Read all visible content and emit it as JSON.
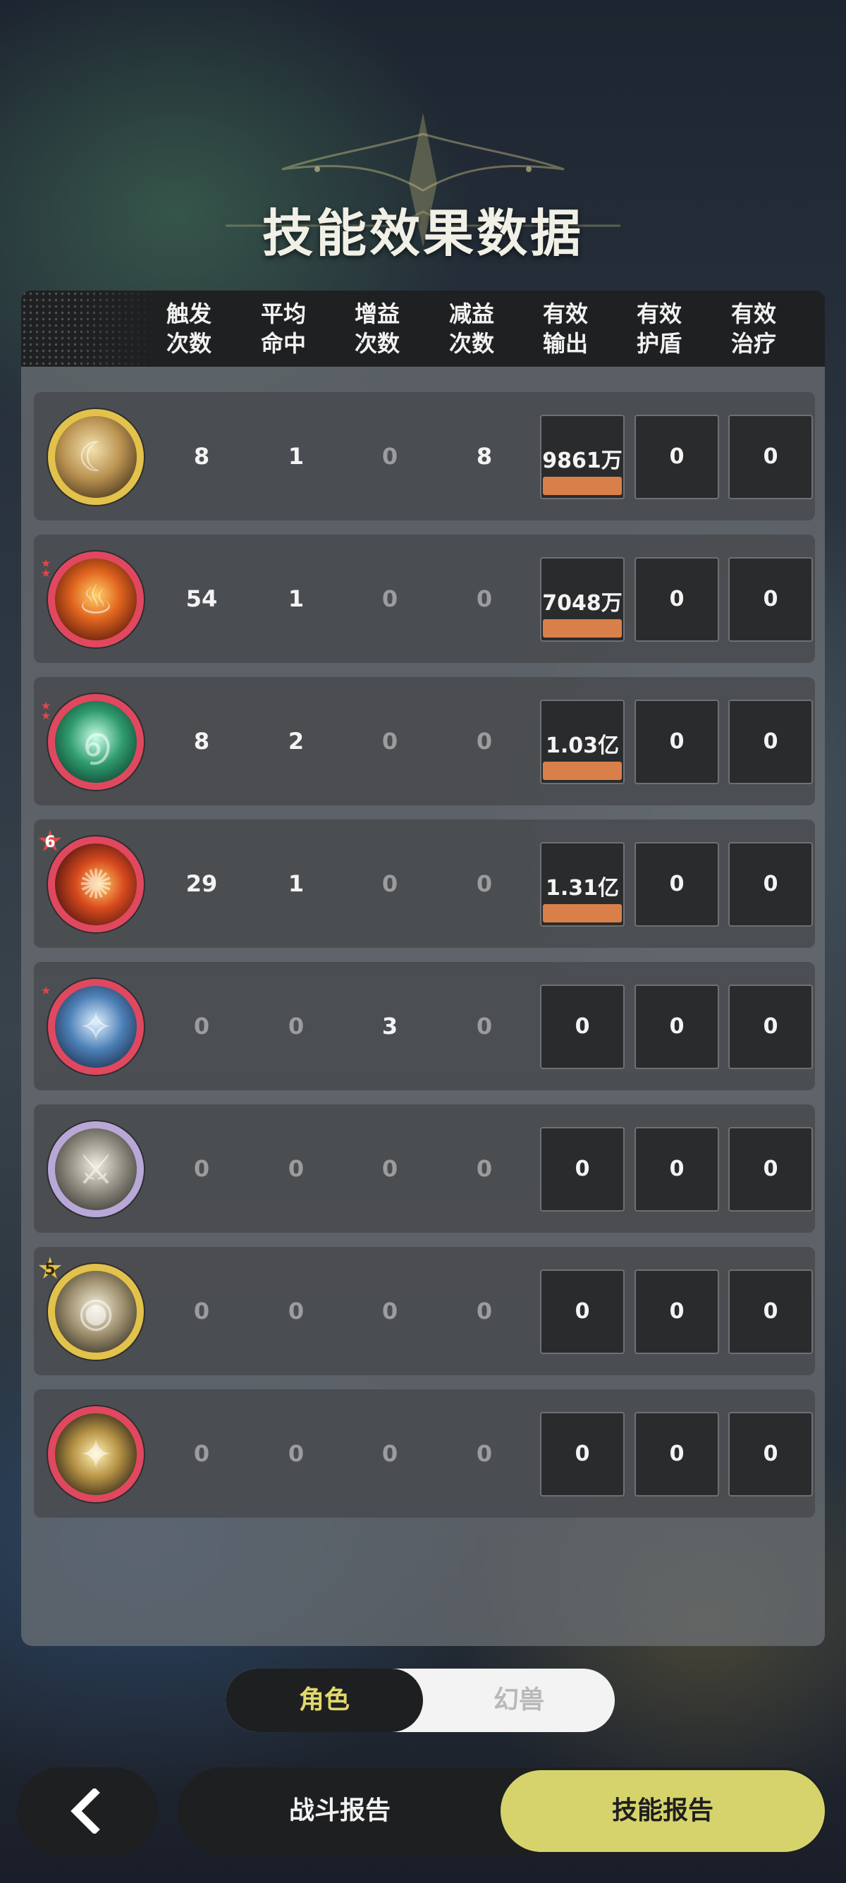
{
  "page": {
    "title": "技能效果数据"
  },
  "table": {
    "headers": [
      "触发\n次数",
      "平均\n命中",
      "增益\n次数",
      "减益\n次数",
      "有效\n输出",
      "有效\n护盾",
      "有效\n治疗"
    ],
    "rows": [
      {
        "icon": "golden-crescent-skill-icon",
        "rank": "",
        "stars": 0,
        "triggers": "8",
        "avg_hits": "1",
        "buffs": "0",
        "debuffs": "8",
        "output": "9861万",
        "output_bar": 1.0,
        "shield": "0",
        "heal": "0"
      },
      {
        "icon": "flame-burst-skill-icon",
        "rank": "",
        "stars": 2,
        "triggers": "54",
        "avg_hits": "1",
        "buffs": "0",
        "debuffs": "0",
        "output": "7048万",
        "output_bar": 1.0,
        "shield": "0",
        "heal": "0"
      },
      {
        "icon": "jade-vortex-skill-icon",
        "rank": "",
        "stars": 2,
        "triggers": "8",
        "avg_hits": "2",
        "buffs": "0",
        "debuffs": "0",
        "output": "1.03亿",
        "output_bar": 1.0,
        "shield": "0",
        "heal": "0"
      },
      {
        "icon": "fire-swirl-skill-icon",
        "rank": "6",
        "stars": 0,
        "triggers": "29",
        "avg_hits": "1",
        "buffs": "0",
        "debuffs": "0",
        "output": "1.31亿",
        "output_bar": 1.0,
        "shield": "0",
        "heal": "0"
      },
      {
        "icon": "ice-crest-skill-icon",
        "rank": "",
        "stars": 1,
        "triggers": "0",
        "avg_hits": "0",
        "buffs": "3",
        "debuffs": "0",
        "output": "0",
        "output_bar": 0,
        "shield": "0",
        "heal": "0"
      },
      {
        "icon": "warrior-strike-skill-icon",
        "rank": "",
        "stars": 0,
        "triggers": "0",
        "avg_hits": "0",
        "buffs": "0",
        "debuffs": "0",
        "output": "0",
        "output_bar": 0,
        "shield": "0",
        "heal": "0"
      },
      {
        "icon": "all-seeing-eye-skill-icon",
        "rank": "5",
        "stars": 0,
        "triggers": "0",
        "avg_hits": "0",
        "buffs": "0",
        "debuffs": "0",
        "output": "0",
        "output_bar": 0,
        "shield": "0",
        "heal": "0"
      },
      {
        "icon": "golden-target-skill-icon",
        "rank": "",
        "stars": 0,
        "triggers": "0",
        "avg_hits": "0",
        "buffs": "0",
        "debuffs": "0",
        "output": "0",
        "output_bar": 0,
        "shield": "0",
        "heal": "0"
      }
    ]
  },
  "toggle": {
    "active": "角色",
    "inactive": "幻兽"
  },
  "bottom": {
    "back_icon": "back-arrow-icon",
    "tab_report": "战斗报告",
    "tab_skill": "技能报告"
  },
  "colors": {
    "accent": "#d6d36c",
    "bar": "#d9804a",
    "toggle_active_text": "#e1d86c"
  }
}
